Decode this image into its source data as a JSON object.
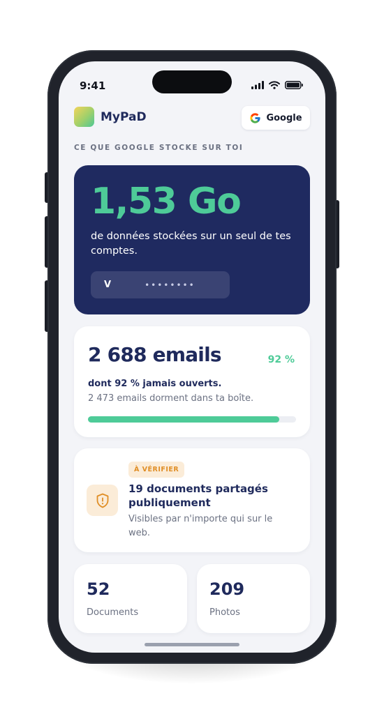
{
  "status_bar": {
    "time": "9:41"
  },
  "header": {
    "app_name": "MyPaD",
    "google_button": "Google"
  },
  "section_title": "CE QUE GOOGLE STOCKE SUR TOI",
  "storage": {
    "value": "1,53 Go",
    "description": "de données stockées sur un seul de tes comptes.",
    "account_initial": "V",
    "account_mask": "••••••••"
  },
  "emails": {
    "count": "2 688 emails",
    "percent": "92 %",
    "percent_value": 92,
    "unopened": "dont 92 % jamais ouverts.",
    "dormant": "2 473 emails dorment dans ta boîte."
  },
  "shared_docs": {
    "badge": "À VÉRIFIER",
    "title": "19 documents partagés publiquement",
    "description": "Visibles par n'importe qui sur le web."
  },
  "stats": [
    {
      "value": "52",
      "label": "Documents"
    },
    {
      "value": "209",
      "label": "Photos"
    }
  ],
  "colors": {
    "navy": "#1f2a60",
    "accent_green": "#4ecb98",
    "warning_orange": "#e08e26",
    "warning_bg": "#fbecd8",
    "screen_bg": "#f3f4f8"
  },
  "icons": [
    "app-logo-icon",
    "google-g-icon",
    "shield-alert-icon",
    "signal-icon",
    "wifi-icon",
    "battery-icon"
  ]
}
